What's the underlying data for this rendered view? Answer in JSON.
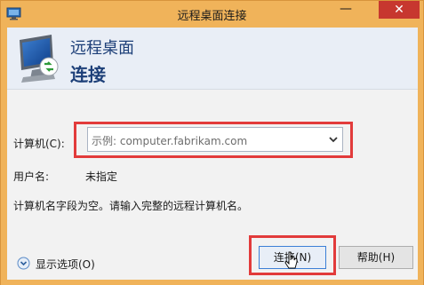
{
  "window": {
    "title": "远程桌面连接",
    "minimize_glyph": "—",
    "close_glyph": "✕",
    "frame_color": "#f0b35a",
    "close_color": "#c7372f"
  },
  "banner": {
    "line1": "远程桌面",
    "line2": "连接",
    "icon": "remote-desktop-monitor-icon",
    "text_color": "#1d3f78"
  },
  "form": {
    "computer_label": "计算机(C):",
    "computer_placeholder": "示例: computer.fabrikam.com",
    "username_label": "用户名:",
    "username_value": "未指定",
    "message": "计算机名字段为空。请输入完整的远程计算机名。"
  },
  "footer": {
    "show_options_label": "显示选项(O)",
    "connect_label": "连接(N)",
    "help_label": "帮助(H)"
  },
  "highlight_color": "#e23b3b"
}
